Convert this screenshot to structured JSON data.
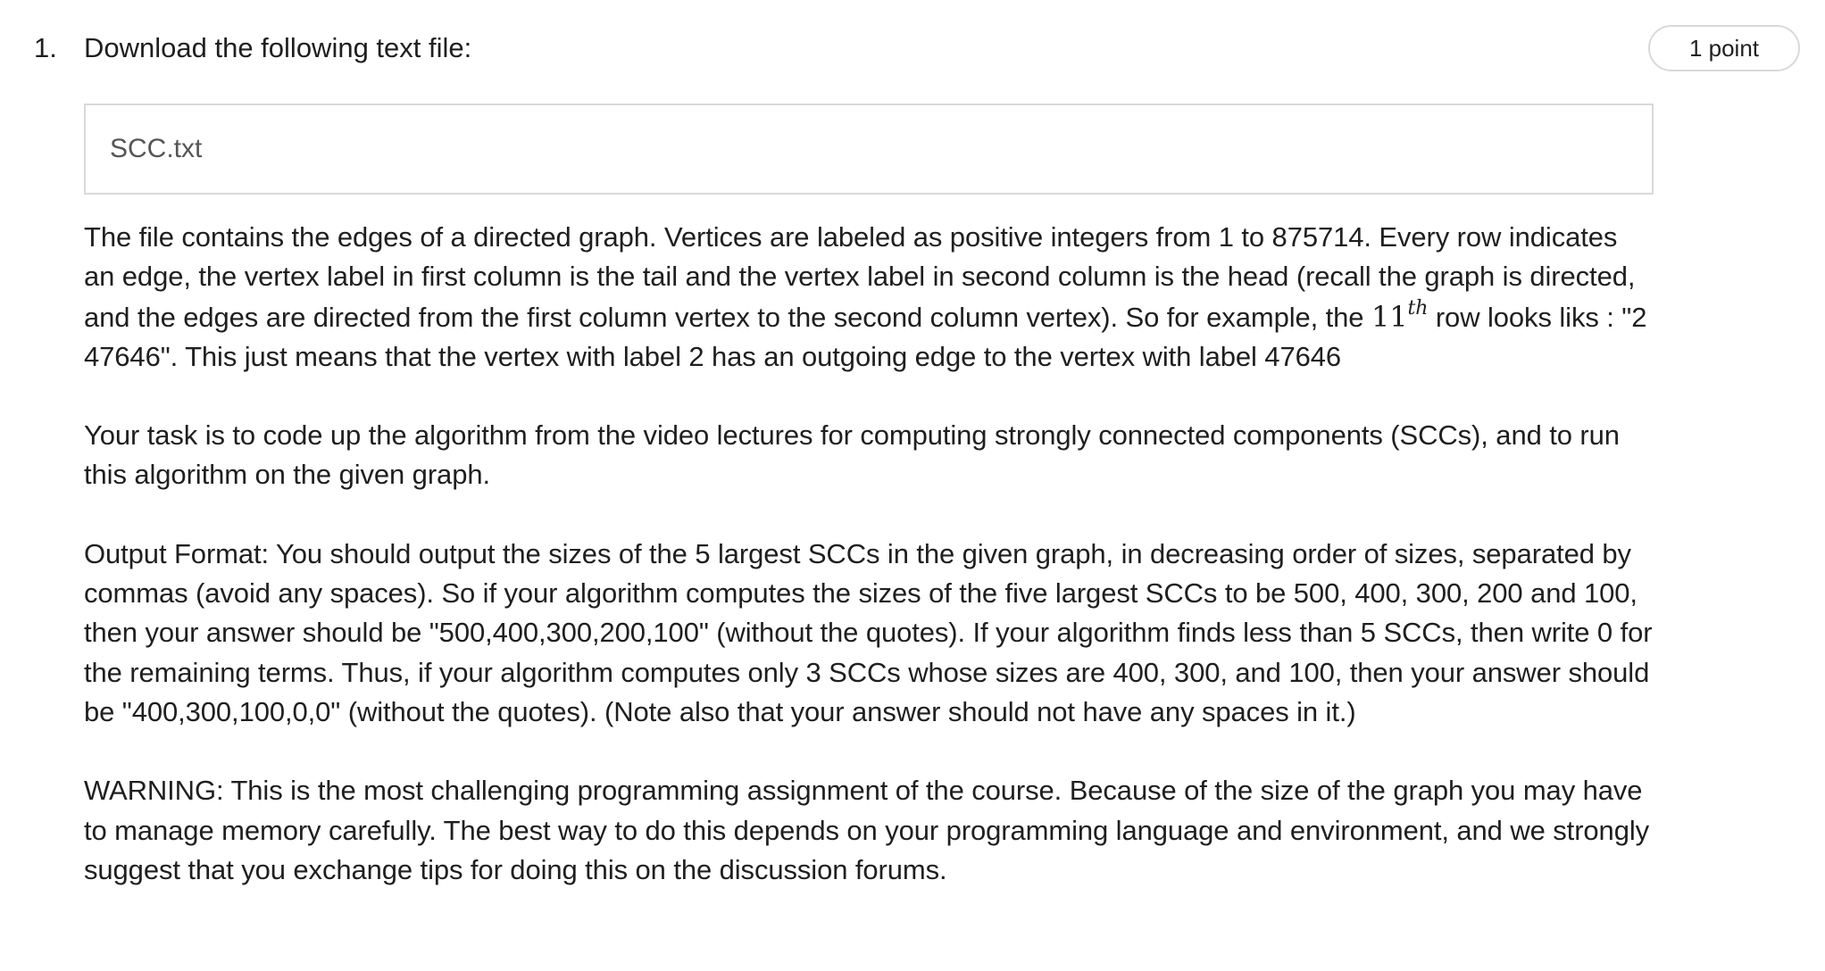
{
  "question": {
    "number": "1.",
    "points": "1 point",
    "prompt": "Download the following text file:",
    "file_name": "SCC.txt",
    "para1_before": "The file contains the edges of a directed graph. Vertices are labeled as positive integers from 1 to 875714. Every row indicates an edge, the vertex label in first column is the tail and the vertex label in second column is the head (recall the graph is directed, and the edges are directed from the first column vertex to the second column vertex). So for example, the ",
    "para1_math_base": "11",
    "para1_math_sup": "th",
    "para1_after": " row looks liks : \"2 47646\". This just means that the vertex with label 2 has an outgoing edge to the vertex with label 47646",
    "para2": "Your task is to code up the algorithm from the video lectures for computing strongly connected components (SCCs), and to run this algorithm on the given graph.",
    "para3": "Output Format: You should output the sizes of the 5 largest SCCs in the given graph, in decreasing order of sizes, separated by commas (avoid any spaces). So if your algorithm computes the sizes of the five largest SCCs to be 500, 400, 300, 200 and 100, then your answer should be \"500,400,300,200,100\" (without the quotes). If your algorithm finds less than 5 SCCs, then write 0 for the remaining terms. Thus, if your algorithm computes only 3 SCCs whose sizes are 400, 300, and 100, then your answer should be \"400,300,100,0,0\" (without the quotes). (Note also that your answer should not have any spaces in it.)",
    "para4": "WARNING: This is the most challenging programming assignment of the course. Because of the size of the graph you may have to manage memory carefully. The best way to do this depends on your programming language and environment, and we strongly suggest that you exchange tips for doing this on the discussion forums."
  }
}
